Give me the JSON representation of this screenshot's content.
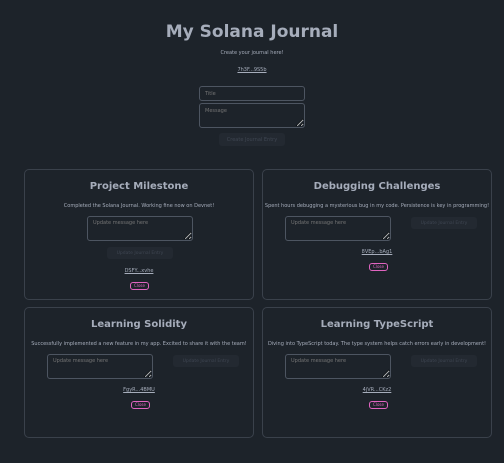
{
  "header": {
    "title": "My Solana Journal",
    "subtitle": "Create your journal here!",
    "wallet": "7h3F...9S5b"
  },
  "form": {
    "title_placeholder": "Title",
    "message_placeholder": "Message",
    "create_label": "Create Journal Entry"
  },
  "entries": [
    {
      "title": "Project Milestone",
      "message": "Completed the Solana Journal. Working fine now on Devnet!",
      "update_placeholder": "Update message here",
      "update_label": "Update Journal Entry",
      "owner": "DSFY...xvhe",
      "delete_label": "Close"
    },
    {
      "title": "Debugging Challenges",
      "message": "Spent hours debugging a mysterious bug in my code. Persistence is key in programming!",
      "update_placeholder": "Update message here",
      "update_label": "Update Journal Entry",
      "owner": "8VEp...bAg1",
      "delete_label": "Close"
    },
    {
      "title": "Learning Solidity",
      "message": "Successfully implemented a new feature in my app. Excited to share it with the team!",
      "update_placeholder": "Update message here",
      "update_label": "Update Journal Entry",
      "owner": "FgyR...4BMU",
      "delete_label": "Close"
    },
    {
      "title": "Learning TypeScript",
      "message": "Diving into TypeScript today. The type system helps catch errors early in development!",
      "update_placeholder": "Update message here",
      "update_label": "Update Journal Entry",
      "owner": "4jVR...CKz2",
      "delete_label": "Close"
    }
  ],
  "colors": {
    "background": "#1d232a",
    "text": "#a6adbb",
    "card_border": "#3a414b",
    "delete_accent": "#e064c0"
  }
}
